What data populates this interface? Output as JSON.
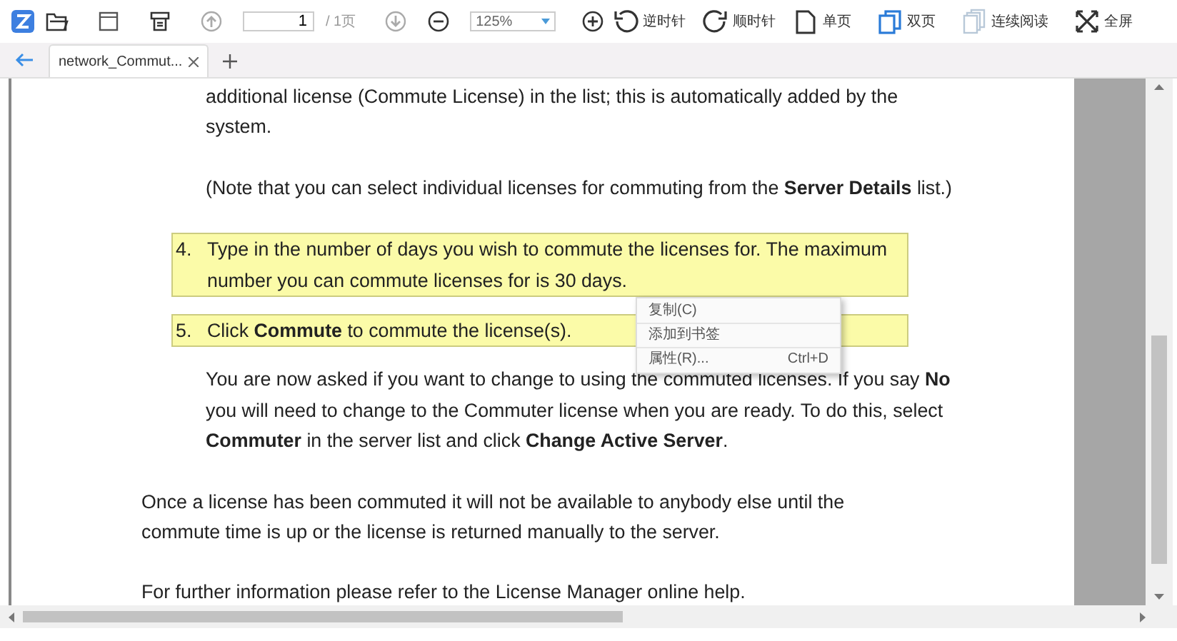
{
  "toolbar": {
    "page_input": "1",
    "page_total": "/ 1页",
    "zoom": "125%",
    "buttons": [
      {
        "label": "逆时针",
        "kind": "ccw"
      },
      {
        "label": "顺时针",
        "kind": "cw"
      },
      {
        "label": "单页",
        "kind": "single"
      },
      {
        "label": "双页",
        "kind": "double"
      },
      {
        "label": "连续阅读",
        "kind": "continuous"
      },
      {
        "label": "全屏",
        "kind": "fullscreen"
      }
    ]
  },
  "tabs": [
    {
      "label": "network_Commut...",
      "selected": true
    }
  ],
  "document": {
    "blocks": [
      {
        "kind": "indented",
        "text": "additional license (Commute License) in the list; this is automatically added by the system."
      },
      {
        "kind": "indented",
        "text": "(Note that you can select individual licenses for commuting from the **Server Details** list.)"
      },
      {
        "kind": "item",
        "number": "4.",
        "highlighted": true,
        "text": "Type in the number of days you wish to commute the licenses for. The maximum number you can commute licenses for is 30 days."
      },
      {
        "kind": "item",
        "number": "5.",
        "highlighted": true,
        "text": "Click **Commute** to commute the license(s)."
      },
      {
        "kind": "indented",
        "text": "You are now asked if you want to change to using the commuted licenses. If you say **No** you will need to change to the Commuter license when you are ready.  To do this, select **Commuter** in the server list and click **Change Active Server**."
      },
      {
        "kind": "plain",
        "text": "Once a license has been commuted it will not be available to anybody else until the commute time is up or the license is returned manually to the server."
      },
      {
        "kind": "plain",
        "text": "For further information please refer to the License Manager online help."
      }
    ]
  },
  "context_menu": {
    "items": [
      {
        "label": "复制(C)"
      },
      {
        "label": "添加到书签"
      },
      {
        "label": "属性(R)...",
        "shortcut": "Ctrl+D"
      }
    ]
  }
}
